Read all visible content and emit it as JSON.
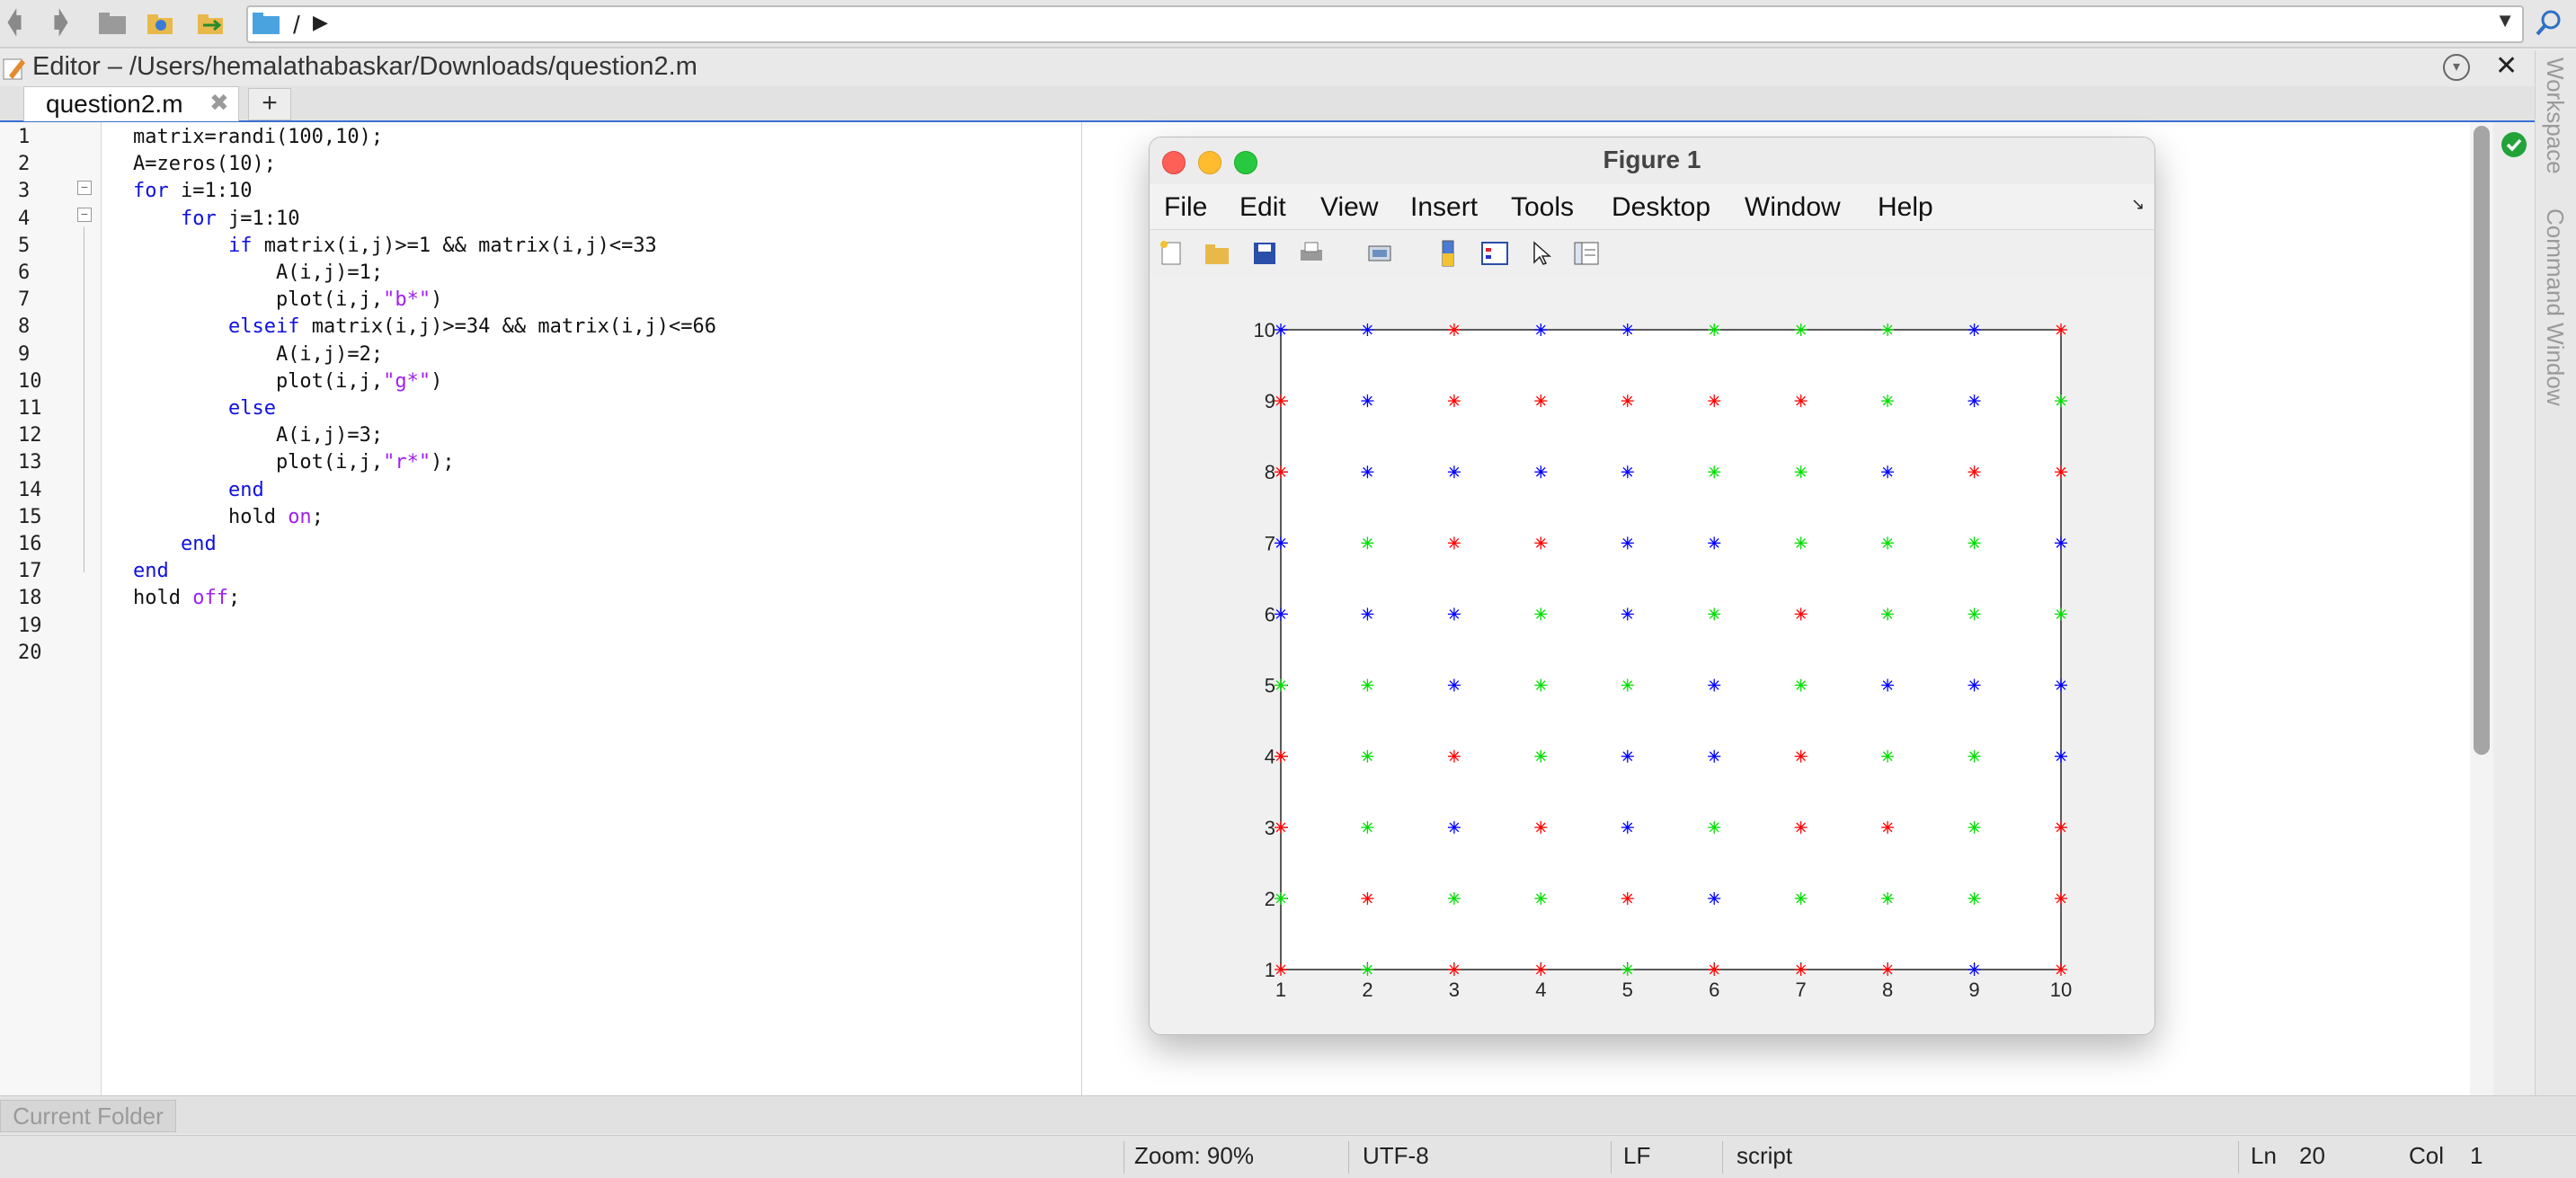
{
  "toolbar": {
    "back_icon": "back-arrow-icon",
    "forward_icon": "forward-arrow-icon",
    "up_icon": "up-folder-icon",
    "browse_icon": "browse-folder-icon",
    "path": "/",
    "path_separator_icon": "chevron-right-icon",
    "search_icon": "search-icon"
  },
  "editor": {
    "title": "Editor – /Users/hemalathabaskar/Downloads/question2.m",
    "tabs": [
      {
        "label": "question2.m"
      }
    ],
    "add_tab_label": "+",
    "line_numbers": [
      "1",
      "2",
      "3",
      "4",
      "5",
      "6",
      "7",
      "8",
      "9",
      "10",
      "11",
      "12",
      "13",
      "14",
      "15",
      "16",
      "17",
      "18",
      "19",
      "20"
    ],
    "code_lines": [
      [
        [
          "p",
          "matrix=randi(100,10);"
        ]
      ],
      [
        [
          "p",
          "A=zeros(10);"
        ]
      ],
      [
        [
          "k",
          "for"
        ],
        [
          "p",
          " i=1:10"
        ]
      ],
      [
        [
          "p",
          "    "
        ],
        [
          "k",
          "for"
        ],
        [
          "p",
          " j=1:10"
        ]
      ],
      [
        [
          "p",
          "        "
        ],
        [
          "k",
          "if"
        ],
        [
          "p",
          " matrix(i,j)>=1 && matrix(i,j)<=33"
        ]
      ],
      [
        [
          "p",
          "            A(i,j)=1;"
        ]
      ],
      [
        [
          "p",
          "            plot(i,j,"
        ],
        [
          "s",
          "\"b*\""
        ],
        [
          "p",
          ")"
        ]
      ],
      [
        [
          "p",
          "        "
        ],
        [
          "k",
          "elseif"
        ],
        [
          "p",
          " matrix(i,j)>=34 && matrix(i,j)<=66"
        ]
      ],
      [
        [
          "p",
          "            A(i,j)=2;"
        ]
      ],
      [
        [
          "p",
          "            plot(i,j,"
        ],
        [
          "s",
          "\"g*\""
        ],
        [
          "p",
          ")"
        ]
      ],
      [
        [
          "p",
          "        "
        ],
        [
          "k",
          "else"
        ]
      ],
      [
        [
          "p",
          "            A(i,j)=3;"
        ]
      ],
      [
        [
          "p",
          "            plot(i,j,"
        ],
        [
          "s",
          "\"r*\""
        ],
        [
          "p",
          ");"
        ]
      ],
      [
        [
          "p",
          "        "
        ],
        [
          "k",
          "end"
        ]
      ],
      [
        [
          "p",
          "        hold "
        ],
        [
          "s",
          "on"
        ],
        [
          "p",
          ";"
        ]
      ],
      [
        [
          "p",
          "    "
        ],
        [
          "k",
          "end"
        ]
      ],
      [
        [
          "k",
          "end"
        ]
      ],
      [
        [
          "p",
          "hold "
        ],
        [
          "s",
          "off"
        ],
        [
          "p",
          ";"
        ]
      ],
      [],
      []
    ]
  },
  "side_tabs": {
    "workspace": "Workspace",
    "command_window": "Command Window"
  },
  "current_folder_label": "Current Folder",
  "status": {
    "zoom": "Zoom: 90%",
    "encoding": "UTF-8",
    "line_ending": "LF",
    "mode": "script",
    "ln_label": "Ln",
    "ln_value": "20",
    "col_label": "Col",
    "col_value": "1"
  },
  "figure": {
    "title": "Figure 1",
    "menus": [
      "File",
      "Edit",
      "View",
      "Insert",
      "Tools",
      "Desktop",
      "Window",
      "Help"
    ],
    "toolbar_icons": [
      "new-figure-icon",
      "open-file-icon",
      "save-icon",
      "print-icon",
      "link-icon",
      "colorbar-icon",
      "legend-icon",
      "pointer-icon",
      "property-inspector-icon"
    ]
  },
  "chart_data": {
    "type": "scatter",
    "marker": "*",
    "colors": {
      "b": "#0000ff",
      "g": "#00dd00",
      "r": "#ff0000"
    },
    "xlim": [
      1,
      10
    ],
    "ylim": [
      1,
      10
    ],
    "x_ticks": [
      "1",
      "2",
      "3",
      "4",
      "5",
      "6",
      "7",
      "8",
      "9",
      "10"
    ],
    "y_ticks": [
      "1",
      "2",
      "3",
      "4",
      "5",
      "6",
      "7",
      "8",
      "9",
      "10"
    ],
    "grid": false,
    "grid_colors_by_row": [
      {
        "y": 10,
        "colors": [
          "b",
          "b",
          "r",
          "b",
          "b",
          "g",
          "g",
          "g",
          "b",
          "r"
        ]
      },
      {
        "y": 9,
        "colors": [
          "r",
          "b",
          "r",
          "r",
          "r",
          "r",
          "r",
          "g",
          "b",
          "g"
        ]
      },
      {
        "y": 8,
        "colors": [
          "r",
          "b",
          "b",
          "b",
          "b",
          "g",
          "g",
          "b",
          "r",
          "r"
        ]
      },
      {
        "y": 7,
        "colors": [
          "b",
          "g",
          "r",
          "r",
          "b",
          "b",
          "g",
          "g",
          "g",
          "b"
        ]
      },
      {
        "y": 6,
        "colors": [
          "b",
          "b",
          "b",
          "g",
          "b",
          "g",
          "r",
          "g",
          "g",
          "g"
        ]
      },
      {
        "y": 5,
        "colors": [
          "g",
          "g",
          "b",
          "g",
          "g",
          "b",
          "g",
          "b",
          "b",
          "b"
        ]
      },
      {
        "y": 4,
        "colors": [
          "r",
          "g",
          "r",
          "g",
          "b",
          "b",
          "r",
          "g",
          "g",
          "b"
        ]
      },
      {
        "y": 3,
        "colors": [
          "r",
          "g",
          "b",
          "r",
          "b",
          "g",
          "r",
          "r",
          "g",
          "r"
        ]
      },
      {
        "y": 2,
        "colors": [
          "g",
          "r",
          "g",
          "g",
          "r",
          "b",
          "g",
          "g",
          "g",
          "r"
        ]
      },
      {
        "y": 1,
        "colors": [
          "r",
          "g",
          "r",
          "r",
          "g",
          "r",
          "r",
          "r",
          "b",
          "r"
        ]
      }
    ]
  }
}
